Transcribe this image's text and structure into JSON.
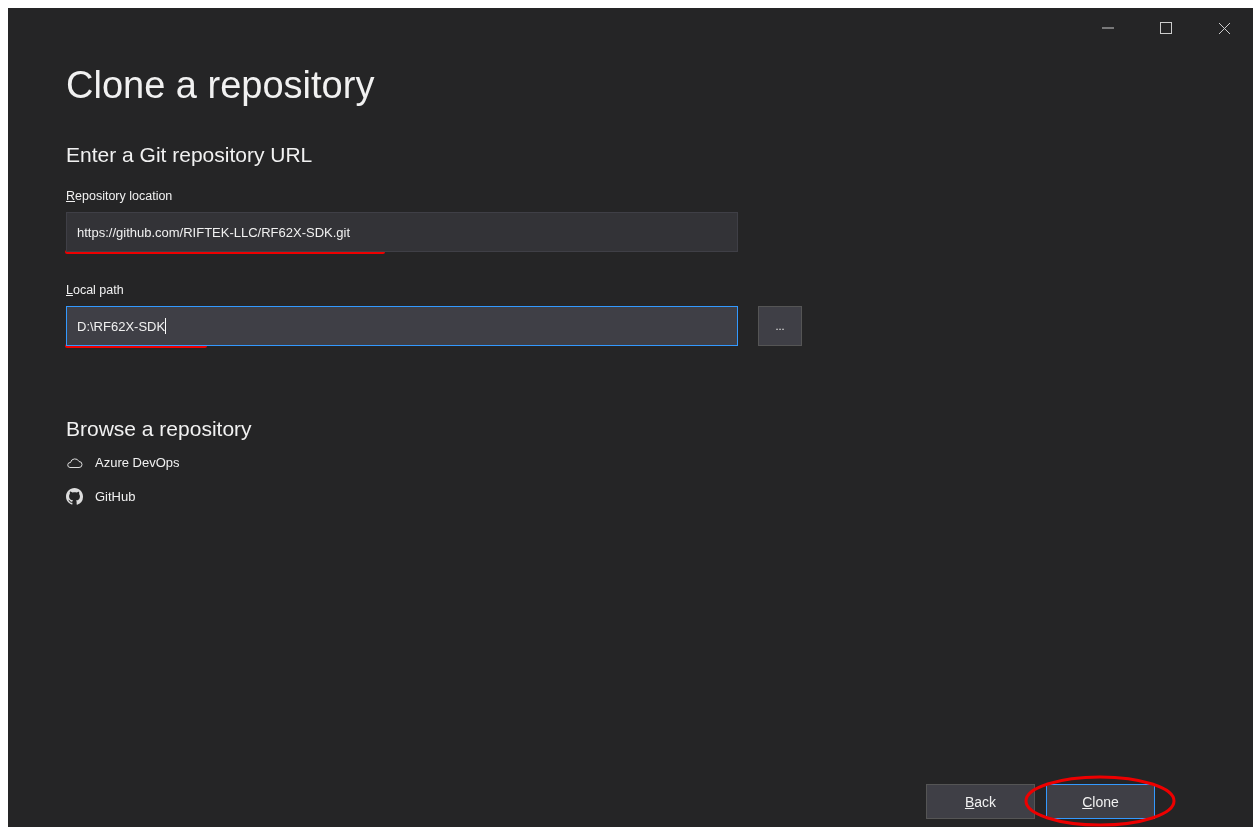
{
  "window": {
    "controls": [
      {
        "kind": "minimize"
      },
      {
        "kind": "maximize"
      },
      {
        "kind": "close"
      }
    ]
  },
  "title": "Clone a repository",
  "url_section": {
    "heading": "Enter a Git repository URL",
    "fields": [
      {
        "label": "Repository location",
        "mnemonic": true,
        "value": "https://github.com/RIFTEK-LLC/RF62X-SDK.git",
        "focused": false,
        "marked": true
      },
      {
        "label": "Local path",
        "mnemonic": true,
        "value": "D:\\RF62X-SDK",
        "focused": true,
        "marked": true,
        "browse_label": "..."
      }
    ]
  },
  "browse_section": {
    "heading": "Browse a repository",
    "items": [
      {
        "kind": "cloud",
        "label": "Azure DevOps"
      },
      {
        "kind": "github",
        "label": "GitHub"
      }
    ]
  },
  "buttons": [
    {
      "label": "Back",
      "mnemonic": true,
      "default": false,
      "marked": false
    },
    {
      "label": "Clone",
      "mnemonic": true,
      "default": true,
      "marked": true
    }
  ]
}
